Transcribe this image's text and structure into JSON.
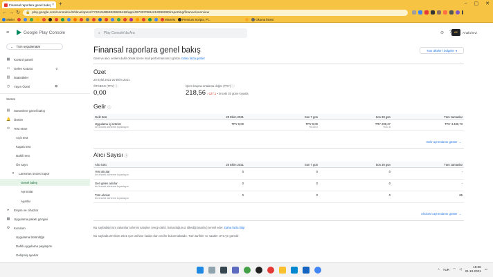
{
  "browser": {
    "tab_title": "Finansal raporlara genel bakış | Y",
    "url": "play.google.com/console/u/0/developers/7740194859325635418/app/4973070594213999080/reporting/finance/overview"
  },
  "bookmarks": [
    "Siteler",
    "",
    "",
    "",
    "",
    "",
    "",
    "",
    "",
    "",
    "",
    "",
    "",
    "",
    "",
    "",
    "",
    "",
    "",
    "",
    "",
    "",
    "",
    "",
    "Mixerist",
    "Premium Scripts, Pl...",
    "",
    "Okuma listesi"
  ],
  "console": {
    "logo_text": "Google Play Console",
    "search_placeholder": "Play Console'da Ara",
    "account_name": "Anaful Evi"
  },
  "sidebar": {
    "all_apps": "Tüm uygulamalar",
    "items": [
      {
        "label": "Kontrol paneli",
        "icon": "dashboard-icon"
      },
      {
        "label": "Gelen Kutusu",
        "icon": "inbox-icon",
        "count": "0"
      },
      {
        "label": "İstatistikler",
        "icon": "stats-icon"
      },
      {
        "label": "Yayın Özeti",
        "icon": "publishing-icon",
        "count": "⊠"
      }
    ],
    "section_release": "Sürüm",
    "release_items": [
      {
        "label": "Sürümlere genel bakış",
        "icon": "overview-icon"
      },
      {
        "label": "Üretim",
        "icon": "production-icon"
      },
      {
        "label": "Test etme",
        "icon": "testing-icon"
      },
      {
        "label": "Açık test",
        "indent": true
      },
      {
        "label": "Kapalı test",
        "indent": true
      },
      {
        "label": "Dahili test",
        "indent": true
      },
      {
        "label": "Ön sayıt",
        "indent": true
      },
      {
        "label": "Lansman öncesi rapor",
        "icon": "chevron-icon",
        "indent": true
      },
      {
        "label": "Genel bakış",
        "indent2": true
      },
      {
        "label": "Ayrıntılar",
        "indent2": true
      },
      {
        "label": "Ayarlar",
        "indent2": true
      },
      {
        "label": "Erişim ve cihazlar",
        "icon": "devices-icon"
      },
      {
        "label": "Uygulama paketi gezgini",
        "icon": "bundle-icon"
      },
      {
        "label": "Kurulum",
        "icon": "setup-icon"
      },
      {
        "label": "Uygulama bütünlüğü",
        "indent": true
      },
      {
        "label": "Dahili uygulama paylaşımı",
        "indent": true
      },
      {
        "label": "Gelişmiş ayarlar",
        "indent": true
      }
    ]
  },
  "page": {
    "title": "Finansal raporlara genel bakış",
    "select_button": "Tüm ülkeler / bölgeler",
    "subtitle": "Gelir ve alıcı verileri dahil olmak üzere mali performansınızı görün.",
    "subtitle_link": "Daha fazla göster",
    "summary": {
      "title": "Özet",
      "date_range": "20 Eylül 2021-20 Ekim 2021",
      "left_label": "ÖTKBGG (TRY) ⓘ",
      "left_value": "0,00",
      "right_label": "İşlem başına ortalama değer (TRY) ⓘ",
      "right_value": "218,56",
      "right_change": "-127,1",
      "right_change_note": "• önceki 30 güne kıyasla"
    },
    "revenue": {
      "title": "Gelir",
      "columns": [
        "Gelir türü",
        "20 Ekim 2021",
        "Son 7 gün",
        "Son 30 gün",
        "Tüm zamanlar"
      ],
      "row_label": "Uygulama içi ürünler",
      "row_sub": "ön önceki döneme kıyaslayın",
      "values": [
        "TRY 0,00",
        "TRY 0,00",
        "TRY 299,27",
        "TRY 4.430,73"
      ],
      "subvalues": [
        "",
        "%100,0",
        "%37,6",
        ""
      ],
      "link": "Gelir ayrıntılarını göster"
    },
    "buyers": {
      "title": "Alıcı Sayısı",
      "columns": [
        "Alıcı türü",
        "20 Ekim 2021",
        "Son 7 gün",
        "Son 30 gün",
        "Tüm zamanlar"
      ],
      "rows": [
        {
          "label": "Yeni alıcılar",
          "sub": "ön önceki döneme kıyaslayın",
          "values": [
            "0",
            "0",
            "0",
            "-"
          ]
        },
        {
          "label": "Geri gelen alıcılar",
          "sub": "ön önceki döneme kıyaslayın",
          "values": [
            "0",
            "0",
            "0",
            "-"
          ]
        },
        {
          "label": "Tüm alıcılar",
          "sub": "ön önceki döneme kıyaslayın",
          "values": [
            "0",
            "0",
            "0",
            "65"
          ]
        }
      ],
      "link": "Alıcıların ayrıntılarını göster"
    },
    "footer1": "Bu sayfadaki tüm rakamlar tahmini satışları (vergi dahil, bulunduğunuz ülkedği tutarlar) temsil eder.",
    "footer1_link": "Daha fazla bilgi",
    "footer2": "Bu sayfada 20 Ekim 2021 Çar tarihine kadar olan veriler bulunmaktadır. Tüm tarihler ve saatler UTC'ye göredir."
  },
  "taskbar": {
    "lang": "TUR",
    "time": "15:36",
    "date": "21.10.2021"
  },
  "colors": {
    "chrome_theme": "#f6c343",
    "brand_green": "#01875f",
    "link": "#1a73e8"
  }
}
